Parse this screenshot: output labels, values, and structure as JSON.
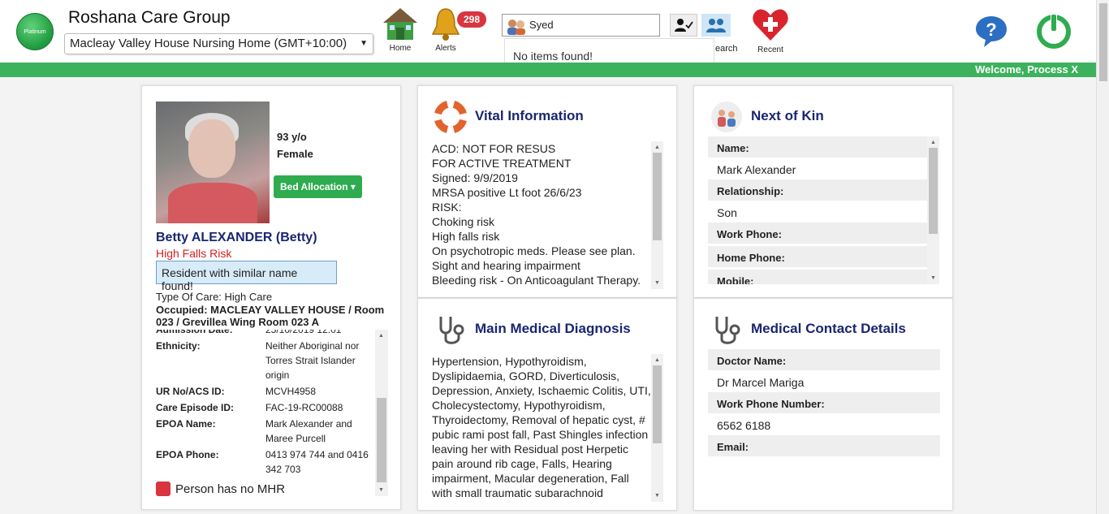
{
  "header": {
    "logo_text": "Platinum",
    "org_name": "Roshana Care Group",
    "facility": "Macleay Valley House Nursing Home (GMT+10:00)",
    "nav": {
      "home": "Home",
      "alerts": "Alerts",
      "alerts_count": "298",
      "search": "earch",
      "recent": "Recent"
    },
    "search_value": "Syed",
    "search_result": "No items found!",
    "welcome": "Welcome, Process X"
  },
  "profile": {
    "age": "93 y/o",
    "gender": "Female",
    "bed_button": "Bed Allocation",
    "name": "Betty ALEXANDER (Betty)",
    "risk": "High Falls Risk",
    "similar_notice": "Resident with similar name found!",
    "type_of_care": "Type Of Care: High Care",
    "occupied": "Occupied: MACLEAY VALLEY HOUSE / Room 023 / Grevillea Wing Room 023 A",
    "details": [
      {
        "label": "Admission Date:",
        "value": "25/10/2019 12:01"
      },
      {
        "label": "Ethnicity:",
        "value": "Neither Aboriginal nor Torres Strait Islander origin"
      },
      {
        "label": "UR No/ACS ID:",
        "value": "MCVH4958"
      },
      {
        "label": "Care Episode ID:",
        "value": "FAC-19-RC00088"
      },
      {
        "label": "EPOA Name:",
        "value": "Mark Alexander and Maree Purcell"
      },
      {
        "label": "EPOA Phone:",
        "value": "0413 974 744 and 0416 342 703"
      }
    ],
    "mhr": "Person has no MHR"
  },
  "vital": {
    "title": "Vital Information",
    "lines": [
      "ACD: NOT FOR RESUS",
      "FOR ACTIVE TREATMENT",
      "Signed: 9/9/2019",
      "MRSA positive Lt foot 26/6/23",
      "RISK:",
      "Choking risk",
      "High falls risk",
      "On psychotropic meds. Please see plan.",
      "Sight and hearing impairment",
      "Bleeding risk - On Anticoagulant Therapy."
    ]
  },
  "nok": {
    "title": "Next of Kin",
    "name_label": "Name:",
    "name_value": "Mark Alexander",
    "rel_label": "Relationship:",
    "rel_value": "Son",
    "work_label": "Work Phone:",
    "home_label": "Home Phone:",
    "mobile_label": "Mobile:"
  },
  "diagnosis": {
    "title": "Main Medical Diagnosis",
    "text": "Hypertension, Hypothyroidism, Dyslipidaemia, GORD, Diverticulosis, Depression, Anxiety, Ischaemic Colitis, UTI, Cholecystectomy, Hypothyroidism, Thyroidectomy, Removal of hepatic cyst, # pubic rami post fall, Past Shingles infection leaving her with Residual post Herpetic pain around rib cage, Falls, Hearing impairment, Macular degeneration, Fall with small traumatic subarachnoid haemorrhage, Osteoarthritis in Hands"
  },
  "medical": {
    "title": "Medical Contact Details",
    "doctor_label": "Doctor Name:",
    "doctor_value": "Dr Marcel Mariga",
    "work_label": "Work Phone Number:",
    "work_value": "6562 6188",
    "email_label": "Email:"
  },
  "colors": {
    "brand_green": "#3cb25c",
    "title_navy": "#1a2670",
    "alert_red": "#d9343f"
  }
}
